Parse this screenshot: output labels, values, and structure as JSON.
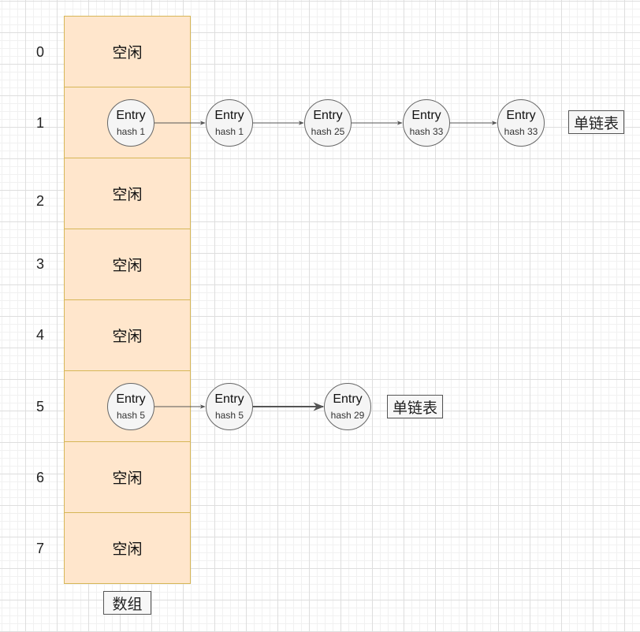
{
  "diagram": {
    "row_indices": [
      "0",
      "1",
      "2",
      "3",
      "4",
      "5",
      "6",
      "7"
    ],
    "array_cells": [
      {
        "label": "空闲"
      },
      {
        "label": ""
      },
      {
        "label": "空闲"
      },
      {
        "label": "空闲"
      },
      {
        "label": "空闲"
      },
      {
        "label": ""
      },
      {
        "label": "空闲"
      },
      {
        "label": "空闲"
      }
    ],
    "array_caption": "数组",
    "chains": [
      {
        "row": 1,
        "nodes": [
          {
            "title": "Entry",
            "hash": "hash 1"
          },
          {
            "title": "Entry",
            "hash": "hash 1"
          },
          {
            "title": "Entry",
            "hash": "hash 25"
          },
          {
            "title": "Entry",
            "hash": "hash 33"
          },
          {
            "title": "Entry",
            "hash": "hash 33"
          }
        ],
        "caption": "单链表"
      },
      {
        "row": 5,
        "nodes": [
          {
            "title": "Entry",
            "hash": "hash 5"
          },
          {
            "title": "Entry",
            "hash": "hash 5"
          },
          {
            "title": "Entry",
            "hash": "hash 29"
          }
        ],
        "caption": "单链表"
      }
    ],
    "colors": {
      "array_fill": "#ffe6cc",
      "array_stroke": "#d6b656",
      "node_fill": "#f5f5f5",
      "node_stroke": "#666666",
      "arrow": "#555555"
    }
  }
}
